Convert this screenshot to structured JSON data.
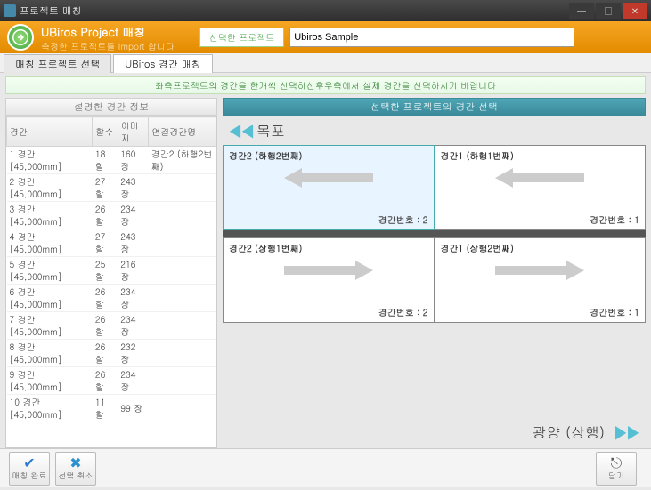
{
  "window": {
    "title": "프로젝트 매칭"
  },
  "header": {
    "title": "UBiros Project 매칭",
    "subtitle": "측정한 프로젝트를 Import 합니다",
    "field_label": "선택한 프로젝트",
    "field_value": "Ubiros Sample"
  },
  "tabs": {
    "items": [
      "매칭 프로젝트 선택",
      "UBiros 경간 매칭"
    ],
    "active": 1
  },
  "hint": "좌측프로젝트의 경간을 한개씩 선택하신후우측에서 실제 경간을 선택하시기 바랍니다",
  "leftPanel": {
    "title": "설명한 경간 정보",
    "columns": [
      "경간",
      "할수",
      "이미지",
      "연결경간명"
    ],
    "rows": [
      {
        "c0": "1 경간 [45,000mm]",
        "c1": "18 할",
        "c2": "160 장",
        "c3": "경간2 (하행2번째)"
      },
      {
        "c0": "2 경간 [45,000mm]",
        "c1": "27 할",
        "c2": "243 장",
        "c3": ""
      },
      {
        "c0": "3 경간 [45,000mm]",
        "c1": "26 할",
        "c2": "234 장",
        "c3": ""
      },
      {
        "c0": "4 경간 [45,000mm]",
        "c1": "27 할",
        "c2": "243 장",
        "c3": ""
      },
      {
        "c0": "5 경간 [45,000mm]",
        "c1": "25 할",
        "c2": "216 장",
        "c3": ""
      },
      {
        "c0": "6 경간 [45,000mm]",
        "c1": "26 할",
        "c2": "234 장",
        "c3": ""
      },
      {
        "c0": "7 경간 [45,000mm]",
        "c1": "26 할",
        "c2": "234 장",
        "c3": ""
      },
      {
        "c0": "8 경간 [45,000mm]",
        "c1": "26 할",
        "c2": "232 장",
        "c3": ""
      },
      {
        "c0": "9 경간 [45,000mm]",
        "c1": "26 할",
        "c2": "234 장",
        "c3": ""
      },
      {
        "c0": "10 경간 [45,000mm]",
        "c1": "11 할",
        "c2": "99 장",
        "c3": ""
      }
    ]
  },
  "rightPanel": {
    "title": "선택한 프로젝트의 경간 선택",
    "nav_left": "목포",
    "nav_right": "광양 (상행)",
    "cards": {
      "top": [
        {
          "title": "경간2 (하행2번째)",
          "num": "경간번호 : 2",
          "dir": "left",
          "selected": true
        },
        {
          "title": "경간1 (하행1번째)",
          "num": "경간번호 : 1",
          "dir": "left",
          "selected": false
        }
      ],
      "bottom": [
        {
          "title": "경간2 (상행1번째)",
          "num": "경간번호 : 2",
          "dir": "right",
          "selected": false
        },
        {
          "title": "경간1 (상행2번째)",
          "num": "경간번호 : 1",
          "dir": "right",
          "selected": false
        }
      ]
    }
  },
  "footer": {
    "done": "매칭 완료",
    "cancel": "선택 취소",
    "close": "닫기"
  }
}
